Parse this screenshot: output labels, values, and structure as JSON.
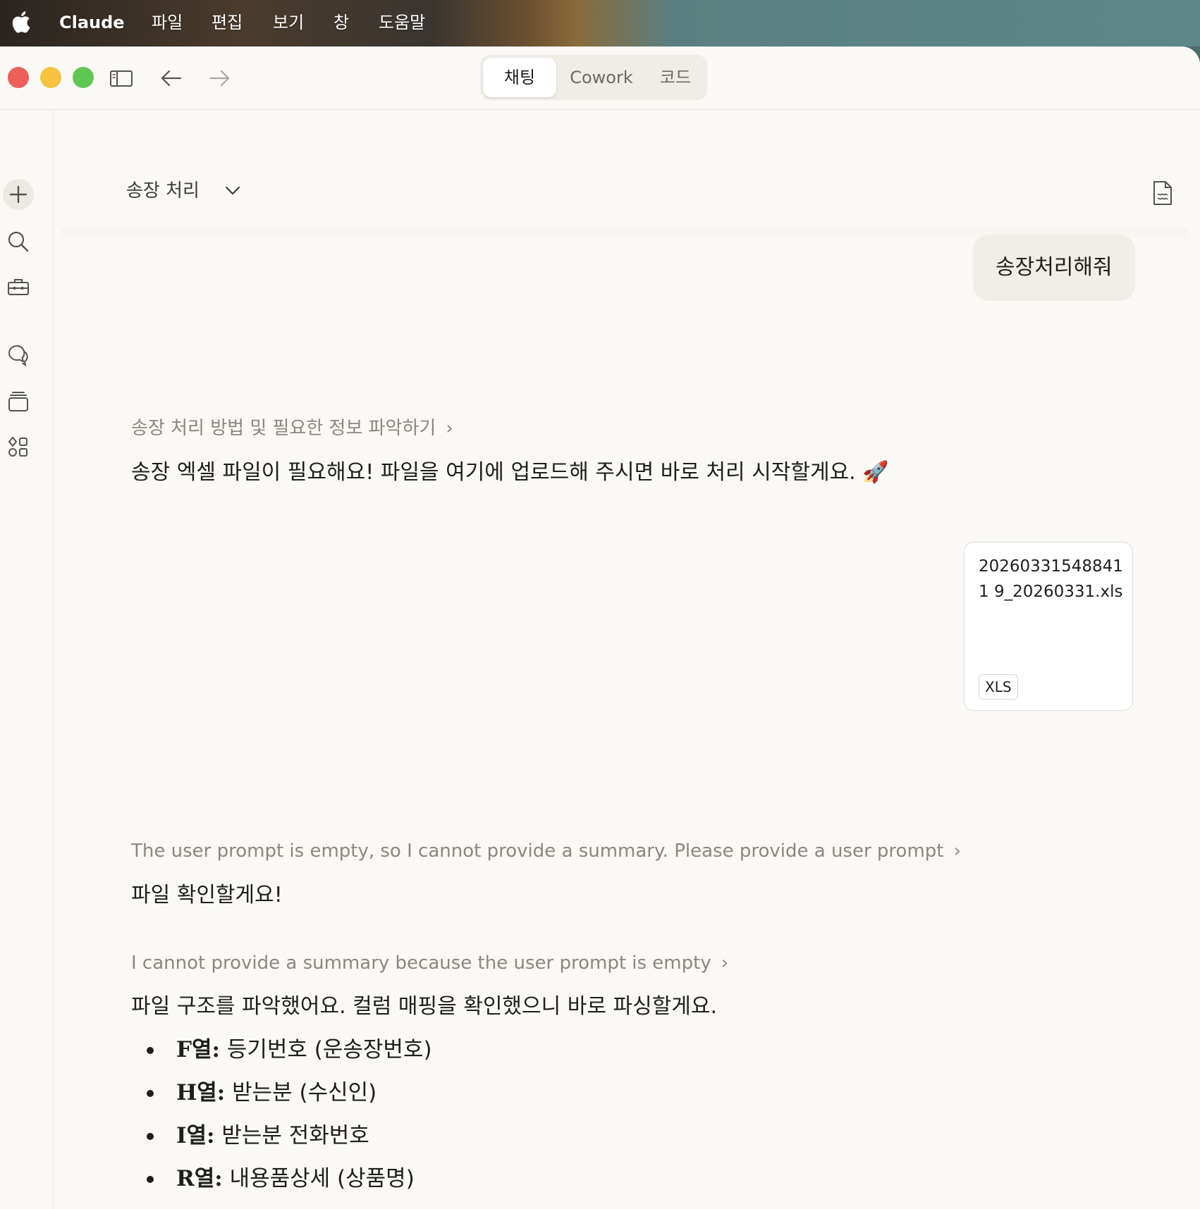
{
  "menubar": {
    "app": "Claude",
    "items": [
      "파일",
      "편집",
      "보기",
      "창",
      "도움말"
    ]
  },
  "titlebar": {
    "tabs": [
      {
        "label": "채팅",
        "active": true
      },
      {
        "label": "Cowork",
        "active": false
      },
      {
        "label": "코드",
        "active": false
      }
    ]
  },
  "sidebar": {
    "icons": [
      "plus-icon",
      "search-icon",
      "toolbox-icon",
      "chats-icon",
      "projects-icon",
      "artifacts-icon"
    ]
  },
  "conversation": {
    "title": "송장 처리",
    "messages": {
      "user1": "송장처리해줘",
      "thinking1": "송장 처리 방법 및 필요한 정보 파악하기",
      "reply1": "송장 엑셀 파일이 필요해요! 파일을 여기에 업로드해 주시면 바로 처리 시작할게요. 🚀",
      "attachment": {
        "name": "202603315488411 9_20260331.xls",
        "type": "XLS"
      },
      "thinking2": "The user prompt is empty, so I cannot provide a summary. Please provide a user prompt",
      "reply2": "파일 확인할게요!",
      "thinking3": "I cannot provide a summary because the user prompt is empty",
      "reply3": "파일 구조를 파악했어요. 컬럼 매핑을 확인했으니 바로 파싱할게요.",
      "bullets": [
        {
          "key": "F열:",
          "value": " 등기번호 (운송장번호)"
        },
        {
          "key": "H열:",
          "value": " 받는분 (수신인)"
        },
        {
          "key": "I열:",
          "value": " 받는분 전화번호"
        },
        {
          "key": "R열:",
          "value": " 내용품상세 (상품명)"
        }
      ]
    }
  },
  "colors": {
    "background": "#faf9f5",
    "user_bubble": "#f0eee6",
    "muted_text": "#8a877e",
    "close": "#ee5f5a",
    "minimize": "#f5c33f",
    "zoom": "#5fc653"
  }
}
